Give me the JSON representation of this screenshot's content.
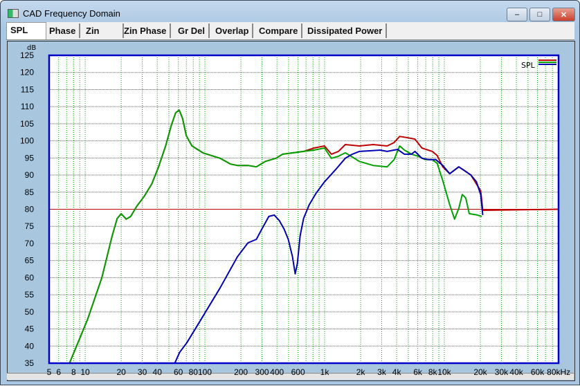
{
  "window": {
    "title": "CAD Frequency Domain",
    "minimize": "–",
    "maximize": "□",
    "close": "✕"
  },
  "tabs": [
    "SPL",
    "Phase",
    "Zin",
    "Zin Phase",
    "Gr Del",
    "Overlap",
    "Compare",
    "Dissipated Power"
  ],
  "active_tab": "SPL",
  "chart_data": {
    "type": "line",
    "ylabel": "dB",
    "xlabel": "",
    "xunit": "Hz",
    "xscale": "log",
    "xlim": [
      5,
      90000
    ],
    "ylim": [
      35,
      125
    ],
    "yticks": [
      35,
      40,
      45,
      50,
      55,
      60,
      65,
      70,
      75,
      80,
      85,
      90,
      95,
      100,
      105,
      110,
      115,
      120,
      125
    ],
    "xtick_labels": [
      [
        5,
        "5"
      ],
      [
        6,
        "6"
      ],
      [
        8,
        "8"
      ],
      [
        10,
        "10"
      ],
      [
        20,
        "20"
      ],
      [
        30,
        "30"
      ],
      [
        40,
        "40"
      ],
      [
        60,
        "60"
      ],
      [
        80,
        "80"
      ],
      [
        100,
        "100"
      ],
      [
        200,
        "200"
      ],
      [
        300,
        "300"
      ],
      [
        400,
        "400"
      ],
      [
        600,
        "600"
      ],
      [
        1000,
        "1k"
      ],
      [
        2000,
        "2k"
      ],
      [
        3000,
        "3k"
      ],
      [
        4000,
        "4k"
      ],
      [
        6000,
        "6k"
      ],
      [
        8000,
        "8k"
      ],
      [
        10000,
        "10k"
      ],
      [
        20000,
        "20k"
      ],
      [
        30000,
        "30k"
      ],
      [
        40000,
        "40k"
      ],
      [
        60000,
        "60k"
      ],
      [
        80000,
        "80kHz"
      ]
    ],
    "grid": true,
    "reference_line_db": 80,
    "legend": {
      "label": "SPL",
      "position": "top-right"
    },
    "colors": {
      "red": "#c00000",
      "green": "#00a000",
      "blue": "#0000b0",
      "grid": "#00a000",
      "frame": "#0000c8"
    },
    "series": [
      {
        "color": "red",
        "points": [
          [
            7.4,
            35
          ],
          [
            10.5,
            47.9
          ],
          [
            13.8,
            60.1
          ],
          [
            16.8,
            72.2
          ],
          [
            18.5,
            77.3
          ],
          [
            20,
            78.7
          ],
          [
            22,
            77.1
          ],
          [
            24,
            77.9
          ],
          [
            27,
            80.9
          ],
          [
            31,
            83.7
          ],
          [
            36,
            87.4
          ],
          [
            41,
            92.4
          ],
          [
            47,
            98.5
          ],
          [
            52.5,
            104.6
          ],
          [
            57,
            108.2
          ],
          [
            61,
            109
          ],
          [
            65,
            106.6
          ],
          [
            70,
            101.5
          ],
          [
            78,
            98.5
          ],
          [
            96,
            96.5
          ],
          [
            134,
            94.9
          ],
          [
            164,
            93.2
          ],
          [
            187,
            92.8
          ],
          [
            229,
            92.8
          ],
          [
            269,
            92.4
          ],
          [
            320,
            94
          ],
          [
            391,
            94.9
          ],
          [
            447,
            96.1
          ],
          [
            667,
            96.9
          ],
          [
            816,
            97.9
          ],
          [
            997,
            98.5
          ],
          [
            1140,
            96.1
          ],
          [
            1304,
            96.9
          ],
          [
            1490,
            98.9
          ],
          [
            1948,
            98.5
          ],
          [
            2546,
            98.9
          ],
          [
            3328,
            98.5
          ],
          [
            3804,
            99.5
          ],
          [
            4234,
            101.3
          ],
          [
            4973,
            100.9
          ],
          [
            5684,
            100.5
          ],
          [
            6500,
            97.9
          ],
          [
            7943,
            96.9
          ],
          [
            8726,
            95.7
          ],
          [
            9710,
            92.4
          ],
          [
            11100,
            90.4
          ],
          [
            13210,
            92.4
          ],
          [
            16680,
            90
          ],
          [
            20120,
            85.4
          ],
          [
            20940,
            79.7
          ],
          [
            90000,
            80
          ]
        ]
      },
      {
        "color": "green",
        "points": [
          [
            7.4,
            35
          ],
          [
            10.5,
            47.9
          ],
          [
            13.8,
            60.1
          ],
          [
            16.8,
            72.2
          ],
          [
            18.5,
            77.3
          ],
          [
            20,
            78.7
          ],
          [
            22,
            77.1
          ],
          [
            24,
            77.9
          ],
          [
            27,
            80.9
          ],
          [
            31,
            83.7
          ],
          [
            36,
            87.4
          ],
          [
            41,
            92.4
          ],
          [
            47,
            98.5
          ],
          [
            52.5,
            104.6
          ],
          [
            57,
            108.2
          ],
          [
            61,
            109
          ],
          [
            65,
            106.6
          ],
          [
            70,
            101.5
          ],
          [
            78,
            98.5
          ],
          [
            96,
            96.5
          ],
          [
            134,
            94.9
          ],
          [
            164,
            93.2
          ],
          [
            187,
            92.8
          ],
          [
            229,
            92.8
          ],
          [
            269,
            92.4
          ],
          [
            320,
            94
          ],
          [
            391,
            94.9
          ],
          [
            447,
            96.1
          ],
          [
            546,
            96.5
          ],
          [
            667,
            96.9
          ],
          [
            816,
            97.3
          ],
          [
            997,
            97.9
          ],
          [
            1140,
            94.9
          ],
          [
            1304,
            95.5
          ],
          [
            1490,
            96.5
          ],
          [
            1703,
            95.3
          ],
          [
            1948,
            94
          ],
          [
            2546,
            92.8
          ],
          [
            3328,
            92.4
          ],
          [
            3804,
            94.5
          ],
          [
            4234,
            98.5
          ],
          [
            4650,
            97.3
          ],
          [
            5316,
            96.1
          ],
          [
            6076,
            95.5
          ],
          [
            6949,
            94.5
          ],
          [
            7943,
            94.5
          ],
          [
            8726,
            93.4
          ],
          [
            9710,
            88.4
          ],
          [
            11100,
            81.3
          ],
          [
            12190,
            77.1
          ],
          [
            13210,
            80.3
          ],
          [
            14130,
            84.3
          ],
          [
            15100,
            83.3
          ],
          [
            16150,
            78.7
          ],
          [
            18960,
            78.3
          ],
          [
            20550,
            77.9
          ]
        ]
      },
      {
        "color": "blue",
        "points": [
          [
            56,
            35
          ],
          [
            61.6,
            38.2
          ],
          [
            70.4,
            40.9
          ],
          [
            89.6,
            46.9
          ],
          [
            134,
            57
          ],
          [
            187,
            66.1
          ],
          [
            229,
            70.2
          ],
          [
            269,
            71.2
          ],
          [
            299,
            74.2
          ],
          [
            342,
            77.9
          ],
          [
            380,
            78.3
          ],
          [
            418,
            76.7
          ],
          [
            459,
            74.2
          ],
          [
            497,
            71.2
          ],
          [
            539,
            66.1
          ],
          [
            568,
            61.1
          ],
          [
            592,
            64.1
          ],
          [
            624,
            72.2
          ],
          [
            667,
            77.3
          ],
          [
            743,
            81.3
          ],
          [
            849,
            84.7
          ],
          [
            997,
            88
          ],
          [
            1222,
            91.4
          ],
          [
            1490,
            94.9
          ],
          [
            1703,
            96.1
          ],
          [
            1948,
            96.9
          ],
          [
            2381,
            97.1
          ],
          [
            2911,
            97.3
          ],
          [
            3328,
            96.9
          ],
          [
            4068,
            97.5
          ],
          [
            4650,
            96.1
          ],
          [
            5316,
            96.1
          ],
          [
            5684,
            96.9
          ],
          [
            6500,
            94.9
          ],
          [
            7430,
            94.5
          ],
          [
            8496,
            94.5
          ],
          [
            9710,
            92.8
          ],
          [
            11100,
            90.4
          ],
          [
            13210,
            92.4
          ],
          [
            14580,
            91.4
          ],
          [
            16680,
            90
          ],
          [
            18560,
            88
          ],
          [
            20120,
            84.3
          ],
          [
            20940,
            78.3
          ]
        ]
      }
    ]
  }
}
